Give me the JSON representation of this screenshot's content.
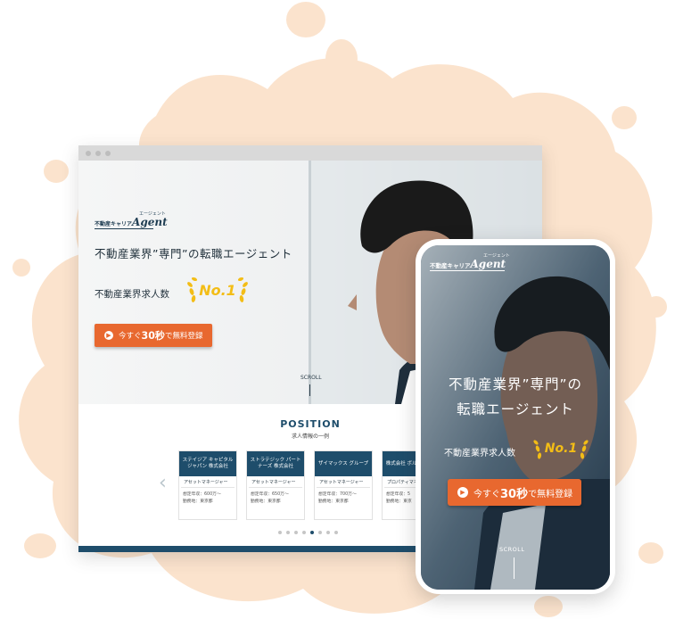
{
  "colors": {
    "accent": "#e8682f",
    "navy": "#1e4d6b",
    "gold": "#f3bd16",
    "splash": "#fbe3cd"
  },
  "logo": {
    "text": "不動産キャリア",
    "brand": "Agent",
    "kana": "エージェント"
  },
  "desktop": {
    "headline": "不動産業界”専門”の転職エージェント",
    "subline": "不動産業界求人数",
    "badge": "No.1",
    "cta_lead": "今すぐ",
    "cta_bold": "30秒",
    "cta_tail": "で無料登録",
    "scroll": "SCROLL",
    "position_title": "POSITION",
    "position_sub": "求人情報の一例",
    "cards": [
      {
        "company": "ステイジア キャピタルジャパン 株式会社",
        "role": "アセットマネージャー",
        "salary": "想定年収：600万〜",
        "location": "勤務地：東京都"
      },
      {
        "company": "ストラテジック パートナーズ 株式会社",
        "role": "アセットマネージャー",
        "salary": "想定年収：650万〜",
        "location": "勤務地：東京都"
      },
      {
        "company": "ザイマックス グループ",
        "role": "アセットマネージャー",
        "salary": "想定年収：700万〜",
        "location": "勤務地：東京都"
      },
      {
        "company": "株式会社 ボルテックス",
        "role": "プロパティマネージャー",
        "salary": "想定年収：5",
        "location": "勤務地：東京"
      }
    ],
    "active_page": 4
  },
  "mobile": {
    "logo_text": "不動産キャリア",
    "logo_brand": "Agent",
    "logo_kana": "エージェント",
    "headline_1": "不動産業界”専門”の",
    "headline_2": "転職エージェント",
    "subline": "不動産業界求人数",
    "badge": "No.1",
    "cta_lead": "今すぐ",
    "cta_bold": "30秒",
    "cta_tail": "で無料登録",
    "scroll": "SCROLL"
  }
}
